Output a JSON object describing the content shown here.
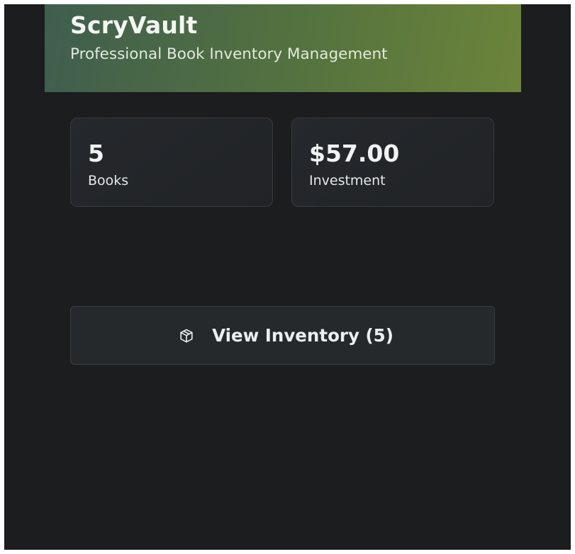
{
  "header": {
    "title": "ScryVault",
    "subtitle": "Professional Book Inventory Management"
  },
  "stats": {
    "books": {
      "value": "5",
      "label": "Books"
    },
    "investment": {
      "value": "$57.00",
      "label": "Investment"
    }
  },
  "actions": {
    "view_inventory": {
      "label": "View Inventory (5)",
      "icon": "box-icon"
    }
  },
  "colors": {
    "background": "#1b1d1f",
    "header_gradient_start": "#3f5e4e",
    "header_gradient_end": "#6c843a",
    "card_background": "#24272a",
    "text_primary": "#f1f2f3"
  }
}
